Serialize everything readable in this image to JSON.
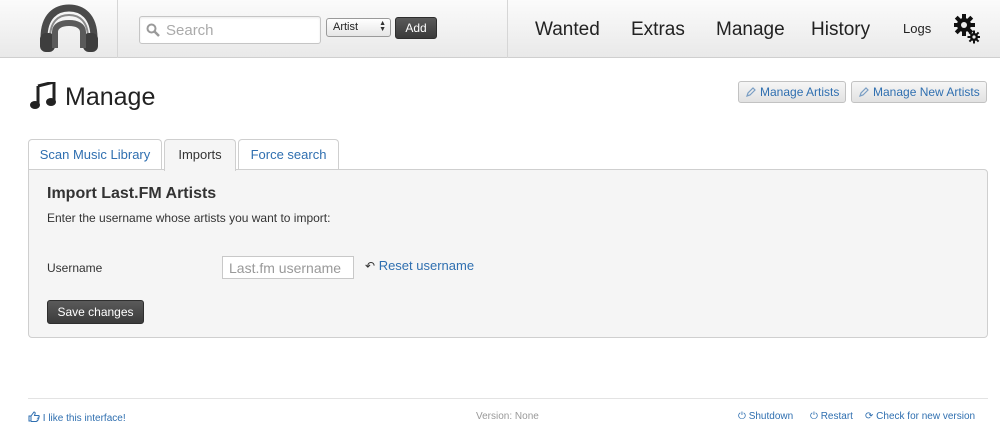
{
  "header": {
    "search": {
      "placeholder": "Search",
      "value": ""
    },
    "search_type": {
      "selected": "Artist"
    },
    "add_label": "Add",
    "nav": [
      "Wanted",
      "Extras",
      "Manage",
      "History"
    ],
    "logs_label": "Logs"
  },
  "page": {
    "title": "Manage",
    "buttons": {
      "manage_artists": "Manage Artists",
      "manage_new_artists": "Manage New Artists"
    }
  },
  "tabs": [
    {
      "label": "Scan Music Library",
      "active": false
    },
    {
      "label": "Imports",
      "active": true
    },
    {
      "label": "Force search",
      "active": false
    }
  ],
  "import_panel": {
    "heading": "Import Last.FM Artists",
    "description": "Enter the username whose artists you want to import:",
    "username_label": "Username",
    "username_placeholder": "Last.fm username",
    "username_value": "",
    "reset_label": "Reset username",
    "save_label": "Save changes"
  },
  "footer": {
    "like": "I like this interface!",
    "version": "Version: None",
    "shutdown": "Shutdown",
    "restart": "Restart",
    "check_update": "Check for new version"
  },
  "colors": {
    "link": "#2f6fb0",
    "dark_button": "#444444"
  }
}
